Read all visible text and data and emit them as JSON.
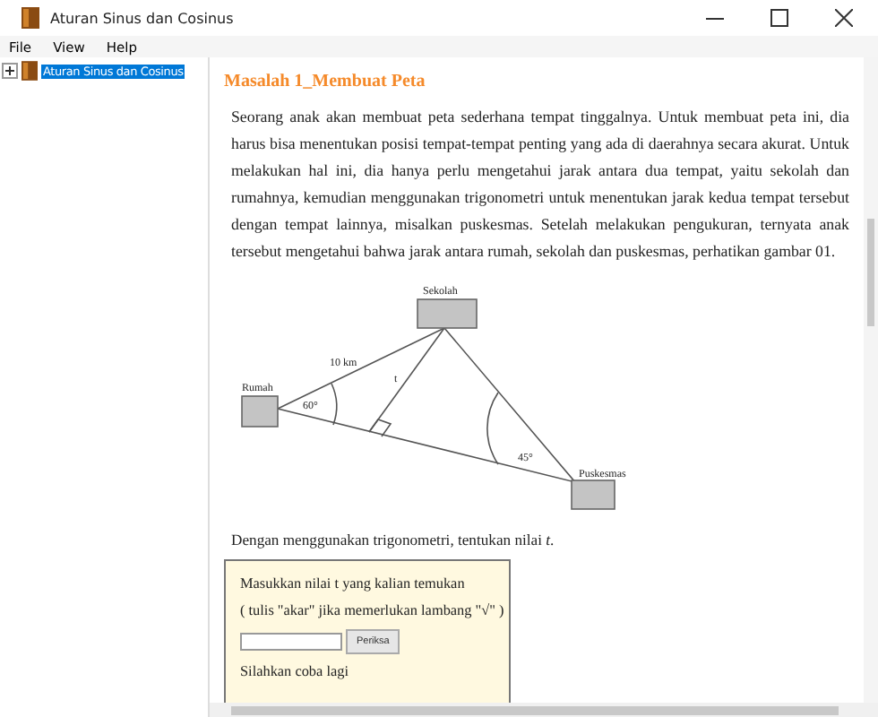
{
  "window": {
    "title": "Aturan Sinus dan Cosinus"
  },
  "menu": [
    "File",
    "View",
    "Help"
  ],
  "tree": [
    {
      "label": "Aturan Sinus dan Cosinus",
      "expanded": false,
      "selected": true
    }
  ],
  "content": {
    "heading": "Masalah 1_Membuat Peta",
    "paragraph": "Seorang anak akan membuat peta sederhana tempat tinggalnya. Untuk membuat peta ini, dia harus bisa menentukan posisi tempat-tempat penting yang ada di daerahnya secara akurat. Untuk melakukan hal ini, dia hanya perlu mengetahui jarak antara dua tempat, yaitu sekolah dan rumahnya, kemudian menggunakan trigonometri untuk menentukan jarak kedua tempat tersebut dengan tempat lainnya, misalkan puskesmas. Setelah melakukan pengukuran, ternyata anak tersebut mengetahui bahwa jarak antara rumah, sekolah dan puskesmas, perhatikan gambar 01.",
    "diagram": {
      "top": "Sekolah",
      "left": "Rumah",
      "right": "Puskesmas",
      "side": "10 km",
      "height": "t",
      "left_angle": "60°",
      "right_angle": "45°"
    },
    "question": "Dengan menggunakan trigonometri, tentukan nilai *t*.",
    "quiz": {
      "prompt": "Masukkan nilai t yang kalian temukan",
      "hint": "( tulis \"akar\" jika memerlukan lambang \"√\" )",
      "button": "Periksa",
      "feedback": "Silahkan coba lagi"
    }
  }
}
